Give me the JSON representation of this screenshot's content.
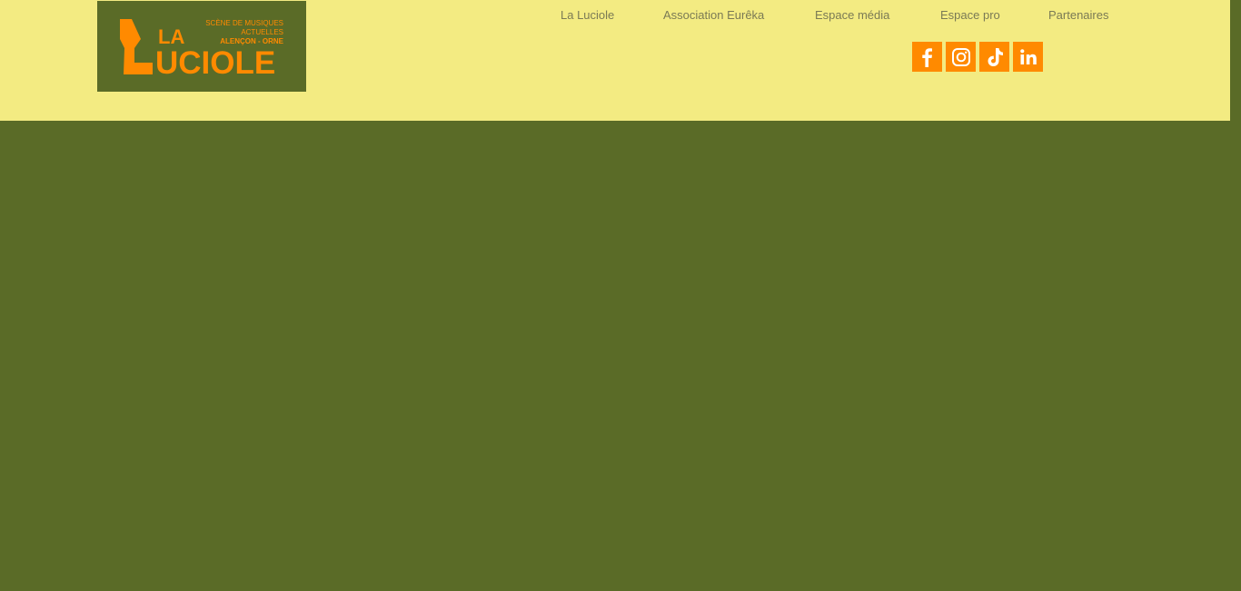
{
  "logo": {
    "line1": "SCÈNE DE MUSIQUES",
    "line2": "ACTUELLES",
    "line3": "ALENÇON - ORNE",
    "la": "LA",
    "name": "UCIOLE"
  },
  "nav": {
    "items": [
      {
        "label": "La Luciole"
      },
      {
        "label": "Association Eurêka"
      },
      {
        "label": "Espace média"
      },
      {
        "label": "Espace pro"
      },
      {
        "label": "Partenaires"
      }
    ]
  },
  "social": {
    "icons": [
      "facebook-icon",
      "instagram-icon",
      "tiktok-icon",
      "linkedin-icon"
    ]
  },
  "colors": {
    "header_bg": "#f3eb82",
    "page_bg": "#5a6b27",
    "accent": "#ff8a00",
    "nav_text": "#7a7a55"
  }
}
